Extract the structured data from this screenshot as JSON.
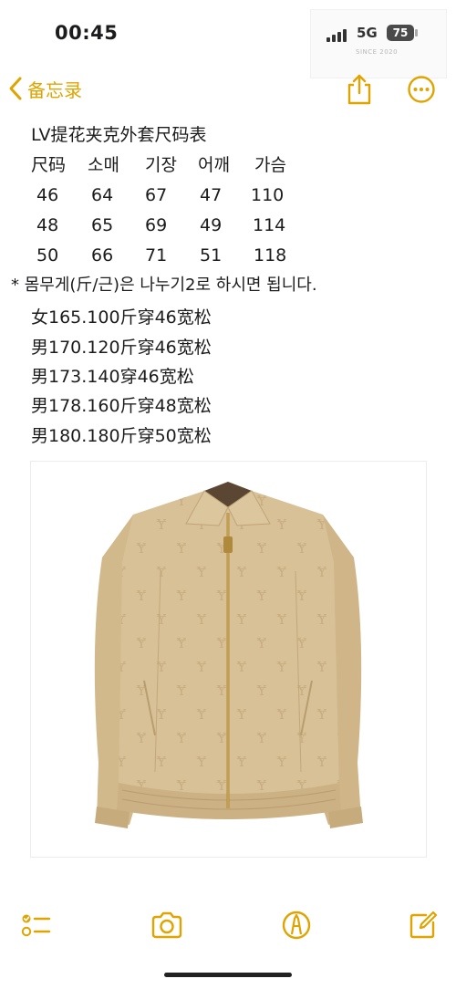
{
  "status_bar": {
    "time": "00:45",
    "network": "5G",
    "battery": "75",
    "watermark_caption": "SINCE 2020"
  },
  "nav": {
    "back_label": "备忘录",
    "accent_color": "#e0a400"
  },
  "note": {
    "title": "LV提花夹克外套尺码表",
    "size_table": {
      "headers": [
        "尺码",
        "소매",
        "기장",
        "어깨",
        "가슴"
      ],
      "rows": [
        [
          "46",
          "64",
          "67",
          "47",
          "110"
        ],
        [
          "48",
          "65",
          "69",
          "49",
          "114"
        ],
        [
          "50",
          "66",
          "71",
          "51",
          "118"
        ]
      ]
    },
    "remark": "* 몸무게(斤/근)은 나누기2로 하시면 됩니다.",
    "fit_notes": [
      "女165.100斤穿46宽松",
      "男170.120斤穿46宽松",
      "男173.140穿46宽松",
      "男178.160斤穿48宽松",
      "男180.180斤穿50宽松"
    ]
  },
  "toolbar": {
    "icons": [
      "checklist-icon",
      "camera-icon",
      "markup-icon",
      "compose-icon"
    ]
  }
}
